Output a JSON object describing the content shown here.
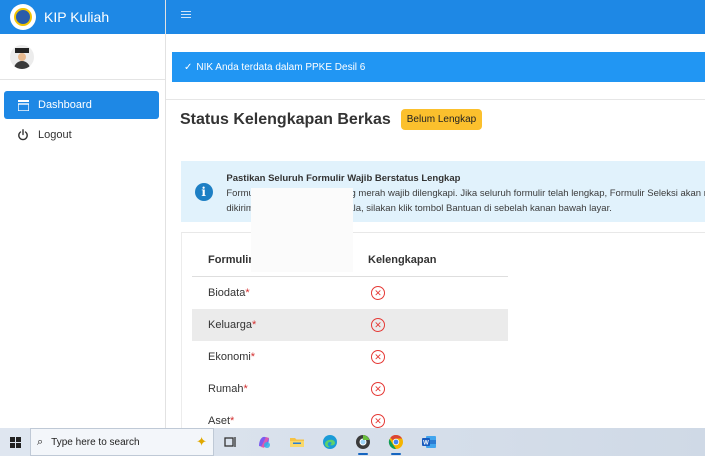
{
  "app": {
    "brand_name": "KIP Kuliah"
  },
  "sidebar": {
    "items": [
      {
        "label": "Dashboard",
        "icon": "dashboard-icon",
        "active": true
      },
      {
        "label": "Logout",
        "icon": "power-icon",
        "active": false
      }
    ]
  },
  "alert": {
    "text": "NIK Anda terdata dalam PPKE Desil 6"
  },
  "page": {
    "title": "Status Kelengkapan Berkas",
    "status_badge": "Belum Lengkap"
  },
  "info": {
    "title": "Pastikan Seluruh Formulir Wajib Berstatus Lengkap",
    "line1": "Formulir dengan tanda bintang merah wajib dilengkapi. Jika seluruh formulir telah lengkap, Formulir Seleksi akan m",
    "line2": "dikirim. Jika mengalami kendala, silakan klik tombol Bantuan di sebelah kanan bawah layar."
  },
  "table": {
    "headers": {
      "form": "Formulir",
      "status": "Kelengkapan"
    },
    "rows": [
      {
        "label": "Biodata",
        "required": "*",
        "status_icon": "x-circle-icon"
      },
      {
        "label": "Keluarga",
        "required": "*",
        "status_icon": "x-circle-icon"
      },
      {
        "label": "Ekonomi",
        "required": "*",
        "status_icon": "x-circle-icon"
      },
      {
        "label": "Rumah",
        "required": "*",
        "status_icon": "x-circle-icon"
      },
      {
        "label": "Aset",
        "required": "*",
        "status_icon": "x-circle-icon"
      }
    ]
  },
  "taskbar": {
    "search_placeholder": "Type here to search",
    "apps": [
      "task-view-icon",
      "copilot-icon",
      "file-explorer-icon",
      "edge-icon",
      "chrome-alt-icon",
      "chrome-icon",
      "word-icon"
    ]
  },
  "colors": {
    "primary": "#1e88e5",
    "alert": "#2196f3",
    "badge": "#fbc02d",
    "info_bg": "#e1f2fc",
    "error": "#e53935"
  }
}
